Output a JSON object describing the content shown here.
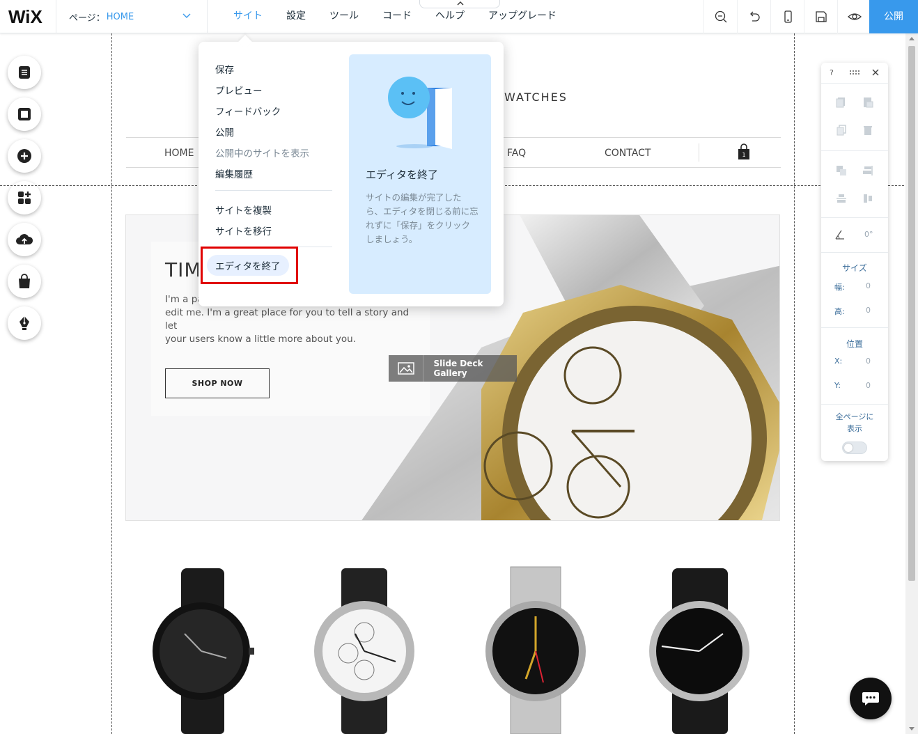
{
  "app": {
    "logo": "WiX"
  },
  "page_select": {
    "prefix": "ページ：",
    "name": "HOME"
  },
  "menu": [
    {
      "label": "サイト",
      "active": true
    },
    {
      "label": "設定"
    },
    {
      "label": "ツール"
    },
    {
      "label": "コード"
    },
    {
      "label": "ヘルプ"
    },
    {
      "label": "アップグレード"
    }
  ],
  "toolbar": {
    "publish_label": "公開"
  },
  "site": {
    "brand": "WATCHES",
    "nav": {
      "home": "HOME",
      "faq": "FAQ",
      "contact": "CONTACT"
    },
    "cart_count": "1",
    "hero": {
      "title": "TIM",
      "text_line1": "I'm a pa",
      "text_line2": "edit me. I'm a great place for you to tell a story and let",
      "text_line3": "your users know a little more about you.",
      "button": "SHOP NOW"
    },
    "gallery_badge": "Slide Deck Gallery"
  },
  "dropdown": {
    "items": [
      "保存",
      "プレビュー",
      "フィードバック",
      "公開",
      "公開中のサイトを表示",
      "編集履歴"
    ],
    "items2": [
      "サイトを複製",
      "サイトを移行"
    ],
    "exit": "エディタを終了",
    "card_title": "エディタを終了",
    "card_desc": "サイトの編集が完了したら、エディタを閉じる前に忘れずに「保存」をクリックしましょう。"
  },
  "panel": {
    "help": "?",
    "rotation": "0°",
    "size_label": "サイズ",
    "width_key": "幅:",
    "width_val": "0",
    "height_key": "高:",
    "height_val": "0",
    "position_label": "位置",
    "x_key": "X:",
    "x_val": "0",
    "y_key": "Y:",
    "y_val": "0",
    "all_pages_line1": "全ページに",
    "all_pages_line2": "表示"
  },
  "colors": {
    "accent": "#3899ec",
    "highlight": "#e00000",
    "card": "#d7ecff"
  }
}
